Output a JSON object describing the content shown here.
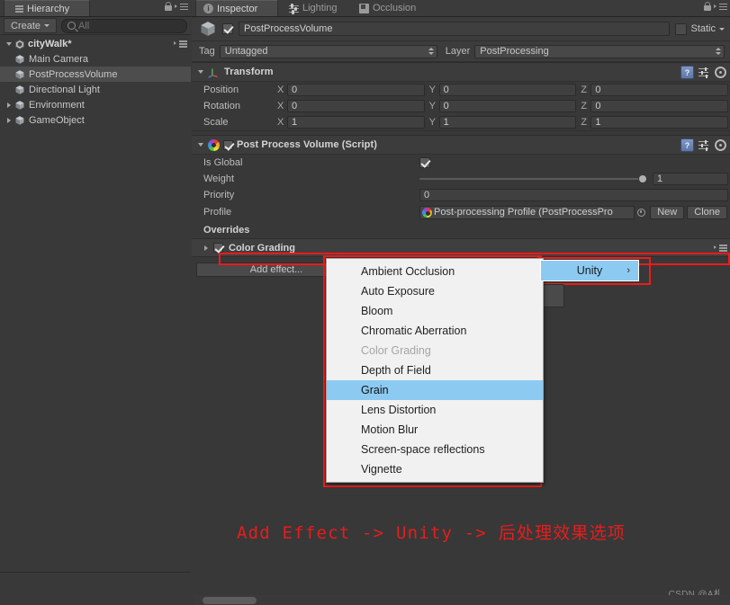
{
  "hierarchy": {
    "tab_label": "Hierarchy",
    "create_label": "Create",
    "search_placeholder": "All",
    "search_value": "",
    "root": {
      "label": "cityWalk*"
    },
    "items": [
      {
        "label": "Main Camera",
        "selected": false,
        "expandable": false
      },
      {
        "label": "PostProcessVolume",
        "selected": true,
        "expandable": false
      },
      {
        "label": "Directional Light",
        "selected": false,
        "expandable": false
      },
      {
        "label": "Environment",
        "selected": false,
        "expandable": true
      },
      {
        "label": "GameObject",
        "selected": false,
        "expandable": true
      }
    ]
  },
  "inspector": {
    "tabs": [
      {
        "label": "Inspector",
        "icon": "info-icon",
        "active": true
      },
      {
        "label": "Lighting",
        "icon": "lighting-icon",
        "active": false
      },
      {
        "label": "Occlusion",
        "icon": "occlusion-icon",
        "active": false
      }
    ],
    "object": {
      "name": "PostProcessVolume",
      "enabled": true,
      "static_label": "Static",
      "static_checked": false,
      "tag_label": "Tag",
      "tag_value": "Untagged",
      "layer_label": "Layer",
      "layer_value": "PostProcessing"
    },
    "transform": {
      "title": "Transform",
      "rows": [
        {
          "name": "Position",
          "x": "0",
          "y": "0",
          "z": "0"
        },
        {
          "name": "Rotation",
          "x": "0",
          "y": "0",
          "z": "0"
        },
        {
          "name": "Scale",
          "x": "1",
          "y": "1",
          "z": "1"
        }
      ],
      "axis_labels": {
        "x": "X",
        "y": "Y",
        "z": "Z"
      }
    },
    "post_process_volume": {
      "title": "Post Process Volume (Script)",
      "enabled": true,
      "is_global_label": "Is Global",
      "is_global_checked": true,
      "weight_label": "Weight",
      "weight_value": "1",
      "priority_label": "Priority",
      "priority_value": "0",
      "profile_label": "Profile",
      "profile_value": "Post-processing Profile (PostProcessPro",
      "new_button": "New",
      "clone_button": "Clone",
      "overrides_label": "Overrides",
      "effects": [
        {
          "label": "Color Grading",
          "checked": true
        }
      ],
      "add_effect_label": "Add effect..."
    }
  },
  "context_menu": {
    "items": [
      {
        "label": "Ambient Occlusion",
        "state": "normal"
      },
      {
        "label": "Auto Exposure",
        "state": "normal"
      },
      {
        "label": "Bloom",
        "state": "normal"
      },
      {
        "label": "Chromatic Aberration",
        "state": "normal"
      },
      {
        "label": "Color Grading",
        "state": "disabled"
      },
      {
        "label": "Depth of Field",
        "state": "normal"
      },
      {
        "label": "Grain",
        "state": "highlight"
      },
      {
        "label": "Lens Distortion",
        "state": "normal"
      },
      {
        "label": "Motion Blur",
        "state": "normal"
      },
      {
        "label": "Screen-space reflections",
        "state": "normal"
      },
      {
        "label": "Vignette",
        "state": "normal"
      }
    ],
    "submenu": {
      "label": "Unity",
      "arrow": "›"
    }
  },
  "annotation": {
    "text": "Add Effect -> Unity -> 后处理效果选项",
    "color": "#e81c1c"
  },
  "watermark": "CSDN @A札",
  "colors": {
    "panel_bg": "#383838",
    "header_bg": "#3c3c3c",
    "selection": "#4d4d4d",
    "menu_bg": "#f1f1f1",
    "menu_highlight": "#8ccaf2",
    "annotation_red": "#e81c1c"
  }
}
